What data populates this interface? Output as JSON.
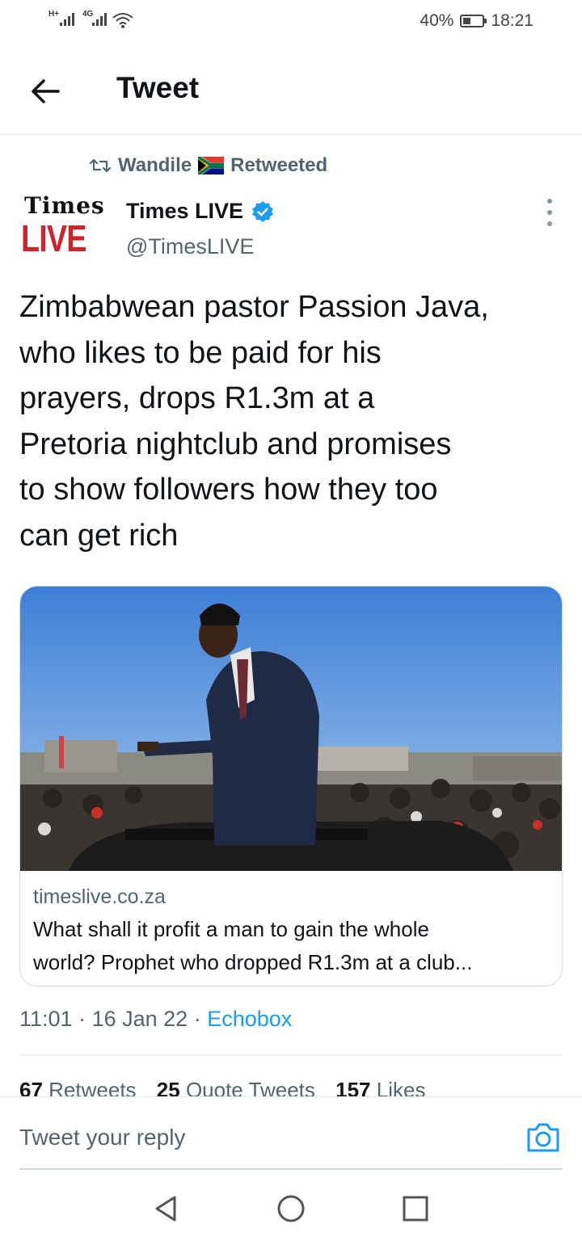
{
  "status_bar": {
    "signal1_label": "H+",
    "signal2_label": "4G",
    "battery_percent": "40%",
    "battery_level": 0.4,
    "time": "18:21"
  },
  "header": {
    "title": "Tweet",
    "back_icon": "arrow-left-icon"
  },
  "retweet": {
    "user": "Wandile",
    "label": "Retweeted",
    "icon": "retweet-icon",
    "flag": "south-africa-flag"
  },
  "author": {
    "logo_top": "Times",
    "logo_bottom": "LIVE",
    "name": "Times LIVE",
    "handle": "@TimesLIVE",
    "verified_icon": "verified-badge-icon"
  },
  "tweet": {
    "text_lines": [
      "Zimbabwean pastor Passion Java,",
      "who likes to be paid for his",
      "prayers, drops R1.3m at a",
      "Pretoria nightclub and promises",
      "to show followers how they too",
      "can get rich"
    ]
  },
  "card": {
    "domain": "timeslive.co.za",
    "title_line1": "What shall it profit a man to gain the whole",
    "title_line2": "world? Prophet who dropped R1.3m at a club..."
  },
  "meta": {
    "time": "11:01",
    "date": "16 Jan 22",
    "source": "Echobox",
    "sep": "·"
  },
  "stats": [
    {
      "count": "67",
      "label": "Retweets"
    },
    {
      "count": "25",
      "label": "Quote Tweets"
    },
    {
      "count": "157",
      "label": "Likes"
    }
  ],
  "reply": {
    "placeholder": "Tweet your reply",
    "camera_icon": "camera-icon"
  },
  "nav": {
    "back": "nav-back-icon",
    "home": "nav-home-icon",
    "recents": "nav-recents-icon"
  },
  "colors": {
    "accent": "#1d9bf0",
    "secondary_text": "#536471",
    "brand_red": "#d2232a"
  }
}
